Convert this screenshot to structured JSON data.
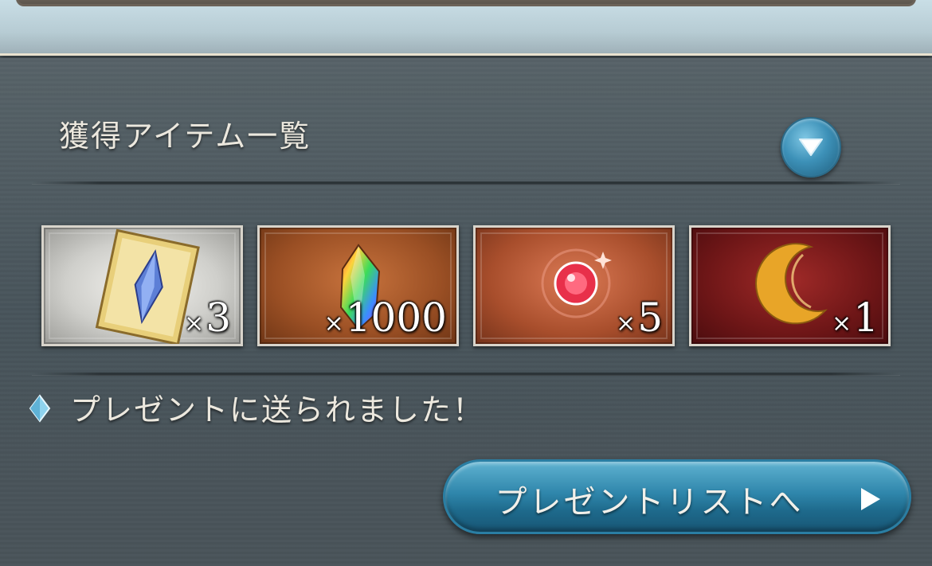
{
  "header": {
    "section_title": "獲得アイテム一覧"
  },
  "toggle": {
    "icon": "triangle-down-icon"
  },
  "items": [
    {
      "name": "crystal-ticket",
      "quantity_prefix": "×",
      "quantity": "3",
      "frame": "silver"
    },
    {
      "name": "rainbow-crystal",
      "quantity_prefix": "×",
      "quantity": "1000",
      "frame": "bronze"
    },
    {
      "name": "red-orb",
      "quantity_prefix": "×",
      "quantity": "5",
      "frame": "rosy"
    },
    {
      "name": "golden-moon",
      "quantity_prefix": "×",
      "quantity": "1",
      "frame": "crimson"
    }
  ],
  "notice": {
    "icon": "diamond-icon",
    "text": "プレゼントに送られました！"
  },
  "present_button": {
    "label": "プレゼントリストへ",
    "icon": "play-arrow-icon"
  },
  "colors": {
    "panel": "#4a555b",
    "button_blue": "#2f86ab",
    "text": "#ece8de"
  }
}
